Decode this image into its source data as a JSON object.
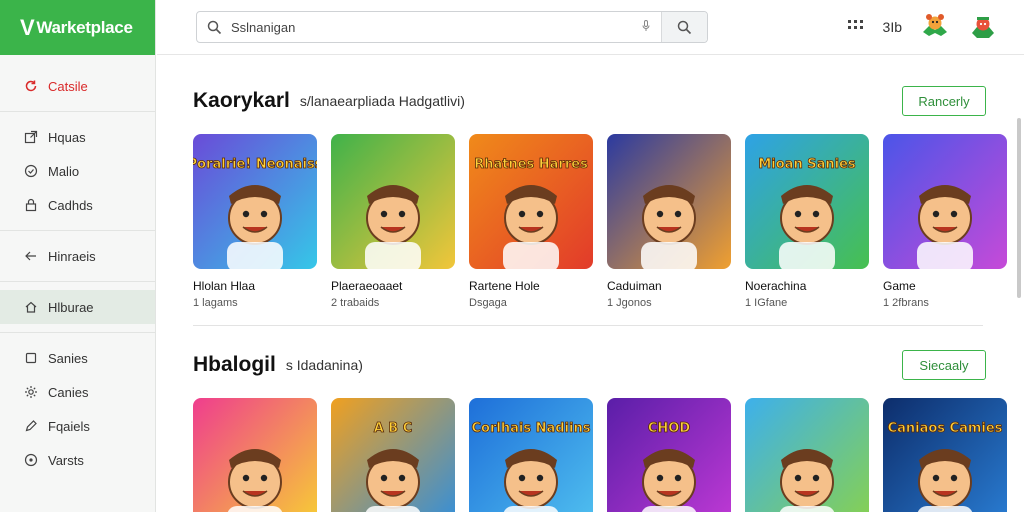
{
  "app": {
    "logo_text": "Warketplace",
    "logo_mark": "V"
  },
  "search": {
    "value": "Sslnanigan"
  },
  "topbar": {
    "count": "3Ib"
  },
  "sidebar": {
    "top_item": "Catsile",
    "items": [
      {
        "label": "Hquas",
        "icon": "external-link-icon"
      },
      {
        "label": "Malio",
        "icon": "circle-check-icon"
      },
      {
        "label": "Cadhds",
        "icon": "lock-icon"
      },
      {
        "label": "Hinraeis",
        "icon": "arrow-left-icon"
      },
      {
        "label": "Hlburae",
        "icon": "home-icon"
      },
      {
        "label": "Sanies",
        "icon": "square-icon"
      },
      {
        "label": "Canies",
        "icon": "gear-icon"
      },
      {
        "label": "Fqaiels",
        "icon": "pen-icon"
      },
      {
        "label": "Varsts",
        "icon": "circle-dot-icon"
      }
    ]
  },
  "sections": [
    {
      "title": "Kaorykarl",
      "subtitle": "s/lanaearpliada Hadgatlivi)",
      "button": "Rancerly",
      "cards": [
        {
          "title": "Hlolan Hlaa",
          "meta": "1 lagams",
          "art_text": "Poralrie! Neonaiss",
          "bg": [
            "#6a4bd8",
            "#35c7e8"
          ]
        },
        {
          "title": "Plaeraeoaaet",
          "meta": "2 trabaids",
          "art_text": "",
          "bg": [
            "#3fb24a",
            "#f2c63a"
          ]
        },
        {
          "title": "Rartene Hole",
          "meta": "Dsgaga",
          "art_text": "Rhatnes Harres",
          "bg": [
            "#f08a1a",
            "#e23b2a"
          ]
        },
        {
          "title": "Caduiman",
          "meta": "1 Jgonos",
          "art_text": "",
          "bg": [
            "#2b3aa0",
            "#f0a030"
          ]
        },
        {
          "title": "Noerachina",
          "meta": "1 IGfane",
          "art_text": "Mioan Sanies",
          "bg": [
            "#2ea2e6",
            "#47c04f"
          ]
        },
        {
          "title": "Game",
          "meta": "1 2fbrans",
          "art_text": "",
          "bg": [
            "#4b55e8",
            "#c64ad8"
          ]
        }
      ]
    },
    {
      "title": "Hbalogil",
      "subtitle": "s Idadanina)",
      "button": "Siecaaly",
      "cards": [
        {
          "title": "",
          "meta": "",
          "art_text": "",
          "bg": [
            "#ef3d8e",
            "#f7d232"
          ]
        },
        {
          "title": "",
          "meta": "",
          "art_text": "A B C",
          "bg": [
            "#f0a020",
            "#2d8ee0"
          ]
        },
        {
          "title": "",
          "meta": "",
          "art_text": "Corlhais Nadiins",
          "bg": [
            "#1e6fd9",
            "#51c2f0"
          ]
        },
        {
          "title": "",
          "meta": "",
          "art_text": "CHOD",
          "bg": [
            "#5a1ea8",
            "#c23ad6"
          ]
        },
        {
          "title": "",
          "meta": "",
          "art_text": "",
          "bg": [
            "#3db0ec",
            "#8ad24a"
          ]
        },
        {
          "title": "",
          "meta": "",
          "art_text": "Caniaos Camies",
          "bg": [
            "#0d2d6b",
            "#2a7fd6"
          ]
        }
      ]
    }
  ],
  "colors": {
    "accent": "#3bb44a",
    "active_bg": "#e3ebe4"
  }
}
